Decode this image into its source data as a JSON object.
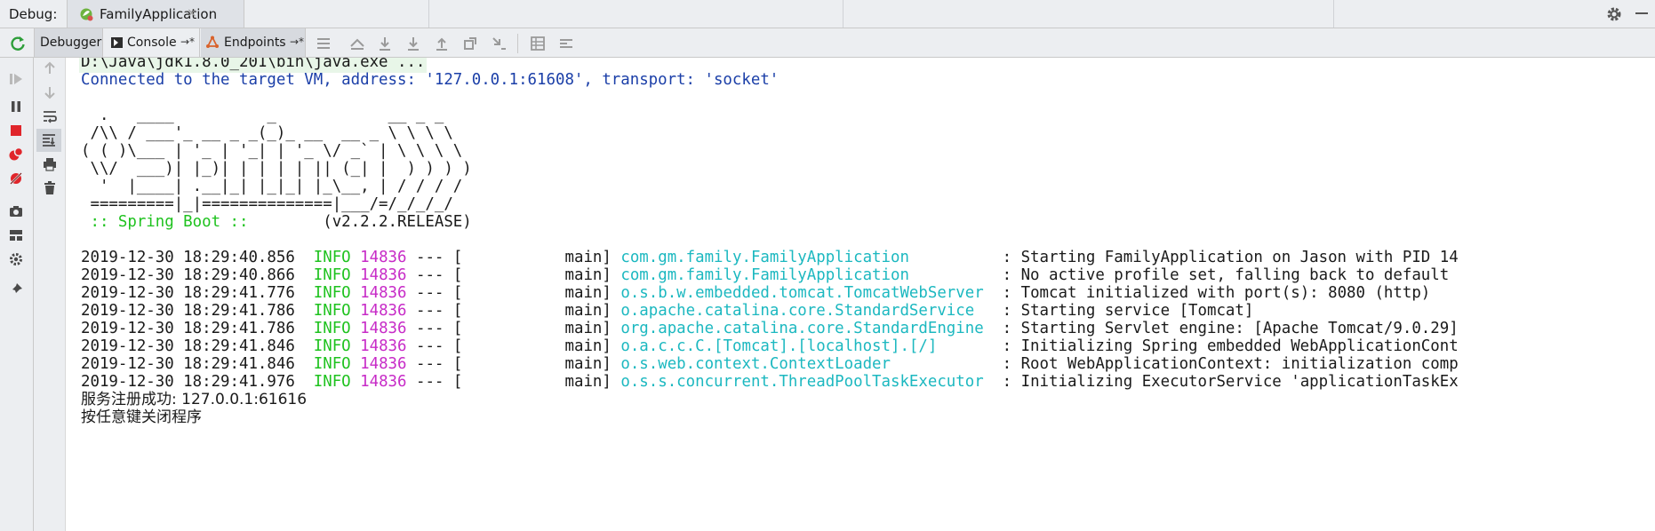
{
  "topbar": {
    "debug_label": "Debug:",
    "run_tab_label": "FamilyApplication",
    "close_symbol": "×"
  },
  "toolbar": {
    "tabs": [
      {
        "label": "Debugger"
      },
      {
        "label": "Console",
        "arrow": "→*"
      },
      {
        "label": "Endpoints",
        "arrow": "→*"
      }
    ],
    "icons": [
      "rerun-icon",
      "menu-lines-icon",
      "show-execution-point-icon",
      "step-over-icon",
      "step-into-icon",
      "force-step-into-icon",
      "step-out-icon",
      "drop-frame-icon",
      "run-to-cursor-icon",
      "evaluate-expression-icon",
      "trace-icon"
    ]
  },
  "gutter_icons": [
    "resume-icon",
    "pause-icon",
    "stop-icon",
    "view-breakpoints-icon",
    "mute-breakpoints-icon",
    "camera-icon",
    "layout-icon",
    "settings-icon",
    "pin-icon",
    "up-arrow-icon",
    "down-arrow-icon",
    "soft-wrap-icon",
    "scroll-to-end-icon",
    "print-icon",
    "trash-icon"
  ],
  "console": {
    "cmd": "D:\\Java\\jdk1.8.0_201\\bin\\java.exe ...",
    "connected": "Connected to the target VM, address: '127.0.0.1:61608', transport: 'socket'",
    "banner": [
      "  .   ____          _            __ _ _",
      " /\\\\ / ___'_ __ _ _(_)_ __  __ _ \\ \\ \\ \\",
      "( ( )\\___ | '_ | '_| | '_ \\/ _` | \\ \\ \\ \\",
      " \\\\/  ___)| |_)| | | | | || (_| |  ) ) ) )",
      "  '  |____| .__|_| |_|_| |_\\__, | / / / /",
      " =========|_|==============|___/=/_/_/_/"
    ],
    "spring_label": " :: Spring Boot :: ",
    "spring_version": "       (v2.2.2.RELEASE)",
    "logs": [
      {
        "ts": "2019-12-30 18:29:40.856",
        "level": "INFO",
        "pid": "14836",
        "sep": "--- [",
        "thread": "           main]",
        "logger": "com.gm.family.FamilyApplication",
        "msg": ": Starting FamilyApplication on Jason with PID 14"
      },
      {
        "ts": "2019-12-30 18:29:40.866",
        "level": "INFO",
        "pid": "14836",
        "sep": "--- [",
        "thread": "           main]",
        "logger": "com.gm.family.FamilyApplication",
        "msg": ": No active profile set, falling back to default"
      },
      {
        "ts": "2019-12-30 18:29:41.776",
        "level": "INFO",
        "pid": "14836",
        "sep": "--- [",
        "thread": "           main]",
        "logger": "o.s.b.w.embedded.tomcat.TomcatWebServer",
        "msg": ": Tomcat initialized with port(s): 8080 (http)"
      },
      {
        "ts": "2019-12-30 18:29:41.786",
        "level": "INFO",
        "pid": "14836",
        "sep": "--- [",
        "thread": "           main]",
        "logger": "o.apache.catalina.core.StandardService",
        "msg": ": Starting service [Tomcat]"
      },
      {
        "ts": "2019-12-30 18:29:41.786",
        "level": "INFO",
        "pid": "14836",
        "sep": "--- [",
        "thread": "           main]",
        "logger": "org.apache.catalina.core.StandardEngine",
        "msg": ": Starting Servlet engine: [Apache Tomcat/9.0.29]"
      },
      {
        "ts": "2019-12-30 18:29:41.846",
        "level": "INFO",
        "pid": "14836",
        "sep": "--- [",
        "thread": "           main]",
        "logger": "o.a.c.c.C.[Tomcat].[localhost].[/]",
        "msg": ": Initializing Spring embedded WebApplicationCont"
      },
      {
        "ts": "2019-12-30 18:29:41.846",
        "level": "INFO",
        "pid": "14836",
        "sep": "--- [",
        "thread": "           main]",
        "logger": "o.s.web.context.ContextLoader",
        "msg": ": Root WebApplicationContext: initialization comp"
      },
      {
        "ts": "2019-12-30 18:29:41.976",
        "level": "INFO",
        "pid": "14836",
        "sep": "--- [",
        "thread": "           main]",
        "logger": "o.s.s.concurrent.ThreadPoolTaskExecutor",
        "msg": ": Initializing ExecutorService 'applicationTaskEx"
      }
    ],
    "reg_success": "服务注册成功: 127.0.0.1:61616",
    "press_any_key": "按任意键关闭程序"
  },
  "colors": {
    "info": "#1ec21e",
    "pid": "#c72bc7",
    "logger": "#1cb8c0",
    "connected": "#1b3fa8",
    "spring": "#1ec21e"
  }
}
